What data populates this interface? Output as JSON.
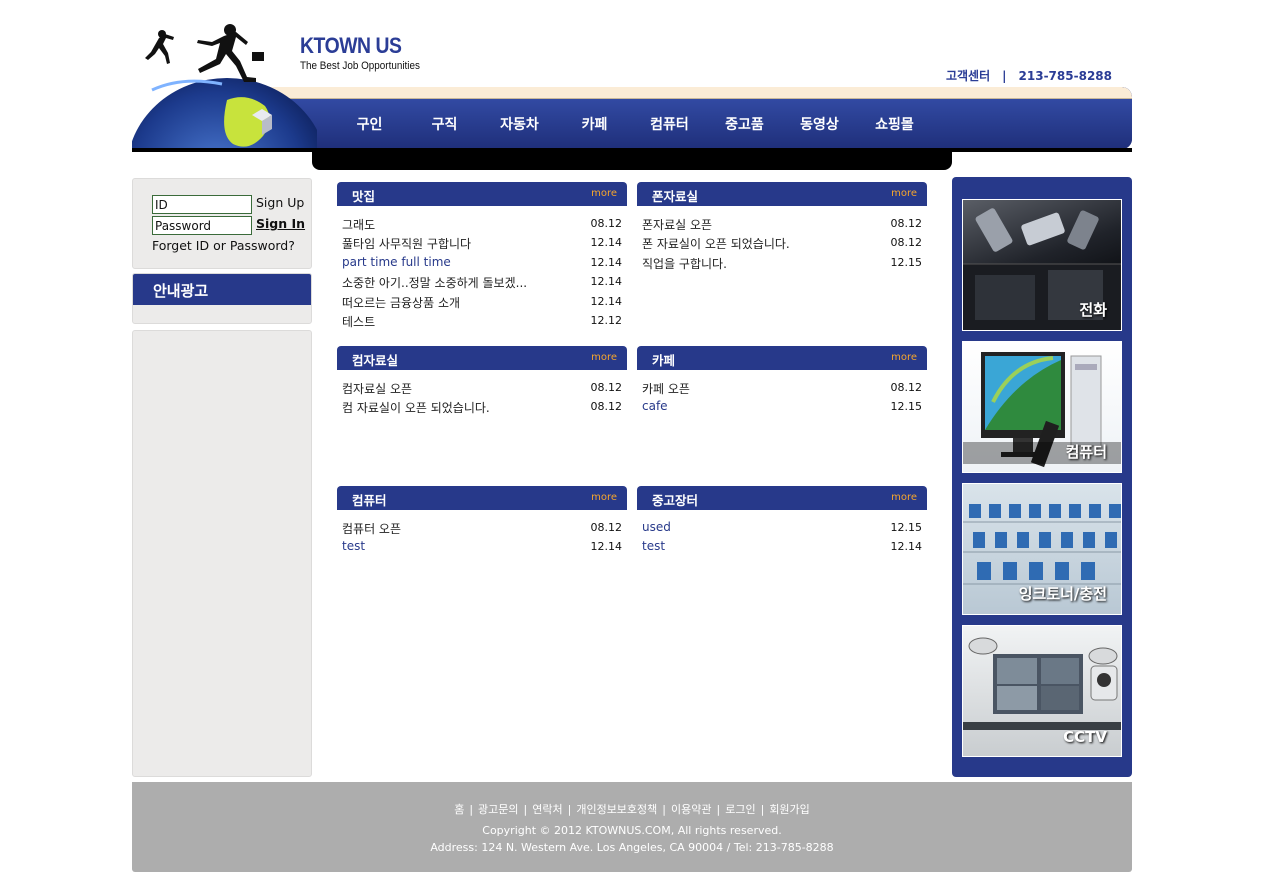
{
  "brand": {
    "name": "KTOWN US",
    "tagline": "The Best Job Opportunities"
  },
  "customer_center": {
    "label": "고객센터",
    "separator": "|",
    "phone": "213-785-8288"
  },
  "nav": [
    "구인",
    "구직",
    "자동차",
    "카페",
    "컴퓨터",
    "중고품",
    "동영상",
    "쇼핑몰"
  ],
  "login": {
    "id_value": "ID",
    "password_value": "Password",
    "sign_up": "Sign Up",
    "sign_in": "Sign In",
    "forgot": "Forget ID or Password?"
  },
  "ad": {
    "title": "안내광고"
  },
  "boards": [
    {
      "title": "맛집",
      "more": "more",
      "items": [
        {
          "title": "그래도",
          "date": "08.12",
          "color": "#222222"
        },
        {
          "title": "풀타임 사무직원 구합니다",
          "date": "12.14",
          "color": "#222222"
        },
        {
          "title": "part time full time",
          "date": "12.14",
          "color": "#27398a"
        },
        {
          "title": "소중한 아기..정말 소중하게 돌보겠...",
          "date": "12.14",
          "color": "#222222"
        },
        {
          "title": "떠오르는 금융상품 소개",
          "date": "12.14",
          "color": "#222222"
        },
        {
          "title": "테스트",
          "date": "12.12",
          "color": "#222222"
        }
      ]
    },
    {
      "title": "폰자료실",
      "more": "more",
      "items": [
        {
          "title": "폰자료실 오픈",
          "date": "08.12",
          "color": "#222222"
        },
        {
          "title": "폰 자료실이 오픈 되었습니다.",
          "date": "08.12",
          "color": "#222222"
        },
        {
          "title": "직업을 구합니다.",
          "date": "12.15",
          "color": "#222222"
        }
      ]
    },
    {
      "title": "컴자료실",
      "more": "more",
      "items": [
        {
          "title": "컴자료실 오픈",
          "date": "08.12",
          "color": "#222222"
        },
        {
          "title": "컴 자료실이 오픈 되었습니다.",
          "date": "08.12",
          "color": "#222222"
        }
      ]
    },
    {
      "title": "카페",
      "more": "more",
      "items": [
        {
          "title": "카페 오픈",
          "date": "08.12",
          "color": "#222222"
        },
        {
          "title": "cafe",
          "date": "12.15",
          "color": "#27398a"
        }
      ]
    },
    {
      "title": "컴퓨터",
      "more": "more",
      "items": [
        {
          "title": "컴퓨터 오픈",
          "date": "08.12",
          "color": "#222222"
        },
        {
          "title": "test",
          "date": "12.14",
          "color": "#27398a"
        }
      ]
    },
    {
      "title": "중고장터",
      "more": "more",
      "items": [
        {
          "title": "used",
          "date": "12.15",
          "color": "#27398a"
        },
        {
          "title": "test",
          "date": "12.14",
          "color": "#27398a"
        }
      ]
    }
  ],
  "promos": [
    {
      "label": "전화",
      "icon": "phone-image"
    },
    {
      "label": "컴퓨터",
      "icon": "computer-image"
    },
    {
      "label": "잉크토너/충전",
      "icon": "ink-toner-image"
    },
    {
      "label": "CCTV",
      "icon": "cctv-image"
    }
  ],
  "footer": {
    "links": [
      "홈",
      "광고문의",
      "연락처",
      "개인정보보호정책",
      "이용약관",
      "로그인",
      "회원가입"
    ],
    "separator": "|",
    "copyright": "Copyright © 2012 KTOWNUS.COM, All rights reserved.",
    "address": "Address: 124 N. Western Ave. Los Angeles, CA 90004 / Tel: 213-785-8288"
  },
  "colors": {
    "primary": "#27398a",
    "more": "#f7a62c",
    "panel": "#ecebea",
    "footer": "#adadad",
    "cream": "#fbecd6"
  }
}
